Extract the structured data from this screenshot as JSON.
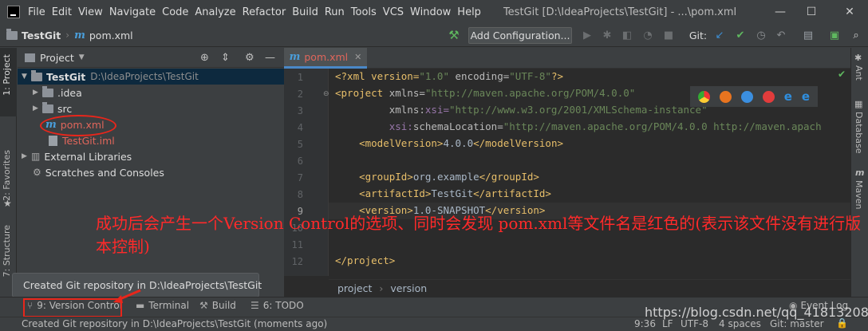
{
  "menu": [
    "File",
    "Edit",
    "View",
    "Navigate",
    "Code",
    "Analyze",
    "Refactor",
    "Build",
    "Run",
    "Tools",
    "VCS",
    "Window",
    "Help"
  ],
  "window_title": "TestGit [D:\\IdeaProjects\\TestGit] - ...\\pom.xml",
  "nav": {
    "project": "TestGit",
    "file": "pom.xml",
    "add_config": "Add Configuration...",
    "git_label": "Git:"
  },
  "left_stripe": {
    "project": "1: Project",
    "favorites": "2: Favorites",
    "structure": "7: Structure"
  },
  "project_panel": {
    "title": "Project"
  },
  "tree": [
    {
      "label": "TestGit",
      "path": "D:\\IdeaProjects\\TestGit"
    },
    {
      "label": ".idea"
    },
    {
      "label": "src"
    },
    {
      "label": "pom.xml"
    },
    {
      "label": "TestGit.iml"
    },
    {
      "label": "External Libraries"
    },
    {
      "label": "Scratches and Consoles"
    }
  ],
  "editor": {
    "tab": "pom.xml",
    "line_numbers": [
      "1",
      "2",
      "3",
      "4",
      "5",
      "6",
      "7",
      "8",
      "9",
      "10",
      "11",
      "12"
    ],
    "lines": [
      [
        "<?xml version=",
        "\"1.0\"",
        " encoding=",
        "\"UTF-8\"",
        "?>"
      ],
      [
        "<project ",
        "xmlns=",
        "\"http://maven.apache.org/POM/4.0.0\""
      ],
      [
        "         ",
        "xmlns:",
        "xsi=",
        "\"http://www.w3.org/2001/XMLSchema-instance\""
      ],
      [
        "         ",
        "xsi:",
        "schemaLocation=",
        "\"http://maven.apache.org/POM/4.0.0 http://maven.apach"
      ],
      [
        "    <modelVersion>",
        "4.0.0",
        "</modelVersion>"
      ],
      [
        ""
      ],
      [
        "    <groupId>",
        "org.example",
        "</groupId>"
      ],
      [
        "    <artifactId>",
        "TestGit",
        "</artifactId>"
      ],
      [
        "    <version>",
        "1.0-SNAPSHOT",
        "</version>"
      ],
      [
        ""
      ],
      [
        ""
      ],
      [
        "</project>"
      ]
    ],
    "breadcrumb": [
      "project",
      "version"
    ]
  },
  "right_stripe": {
    "ant": "Ant",
    "database": "Database",
    "maven": "Maven"
  },
  "balloon": "Created Git repository in D:\\IdeaProjects\\TestGit",
  "tool_windows": {
    "vc": "9: Version Control",
    "terminal": "Terminal",
    "build": "Build",
    "todo": "6: TODO",
    "event_log": "Event Log"
  },
  "status": {
    "message": "Created Git repository in D:\\IdeaProjects\\TestGit (moments ago)",
    "position": "9:36",
    "line_sep": "LF",
    "encoding": "UTF-8",
    "indent": "4 spaces",
    "branch": "Git: master"
  },
  "annotation": "成功后会产生一个Version Control的选项、同时会发现 pom.xml等文件名是红色的(表示该文件没有进行版本控制)",
  "watermark": "https://blog.csdn.net/qq_41813208",
  "colors": {
    "accent": "#4a88c7",
    "unversioned": "#e0665b",
    "annotation": "#ff2a2a"
  }
}
